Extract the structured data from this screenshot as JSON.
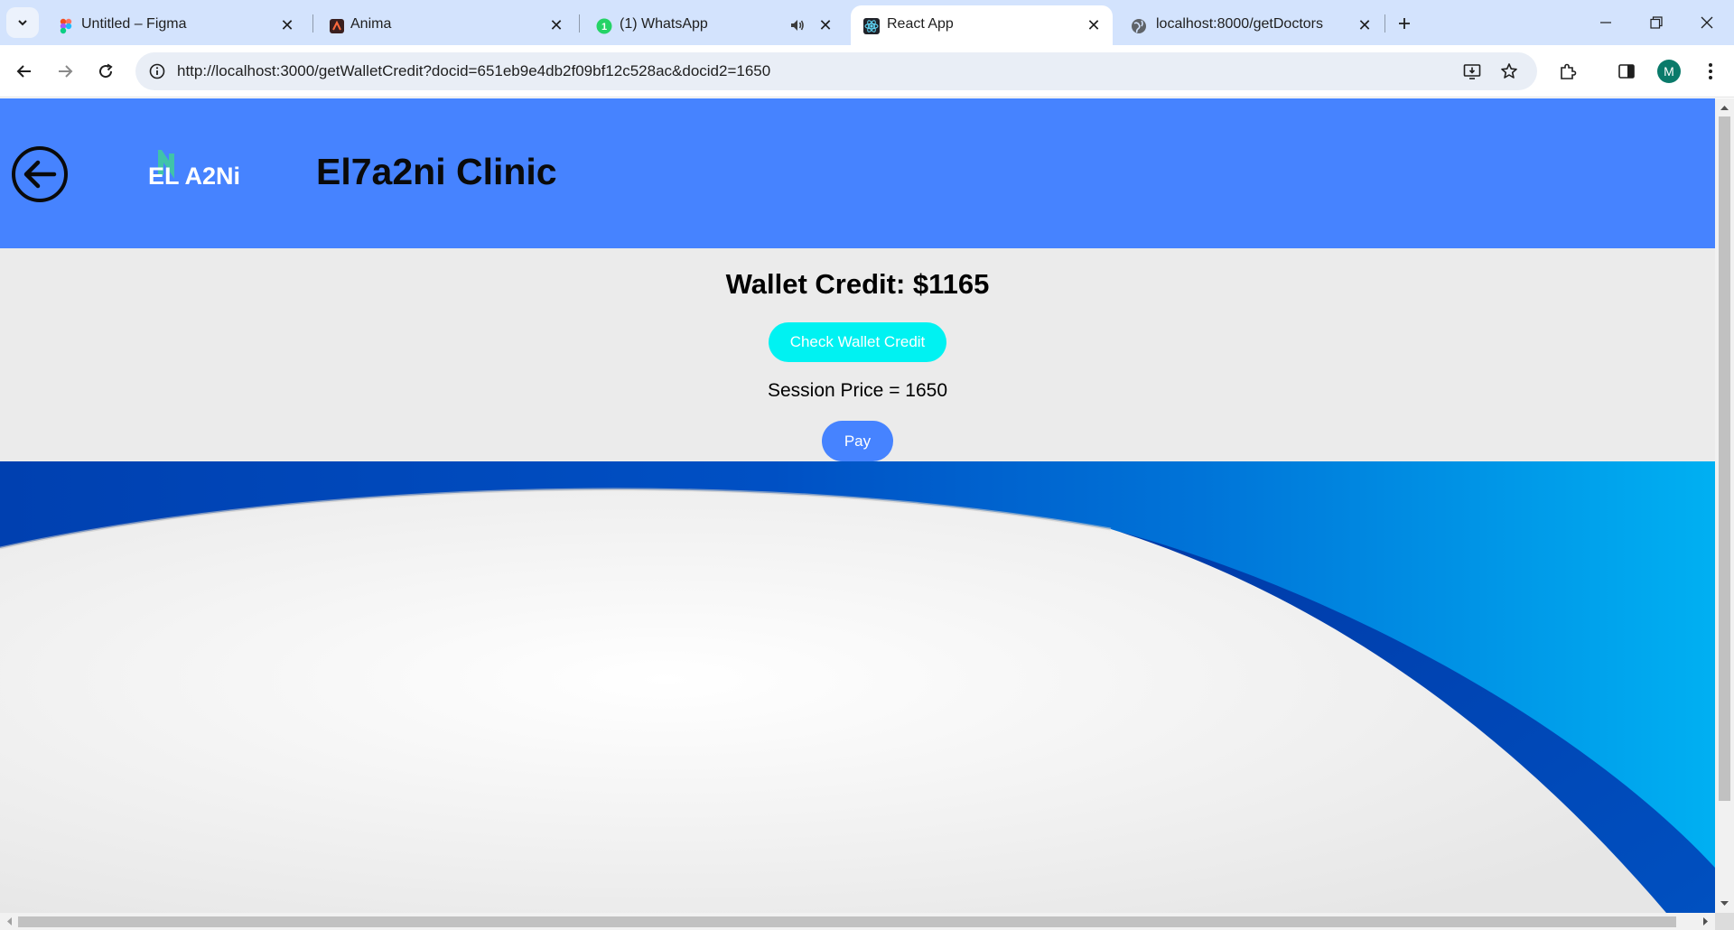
{
  "browser": {
    "tabs": [
      {
        "title": "Untitled – Figma",
        "icon": "figma-icon",
        "active": false
      },
      {
        "title": "Anima",
        "icon": "anima-icon",
        "active": false
      },
      {
        "title": "(1) WhatsApp",
        "icon": "whatsapp-icon",
        "badge": "1",
        "audio": true,
        "active": false
      },
      {
        "title": "React App",
        "icon": "react-icon",
        "active": true
      },
      {
        "title": "localhost:8000/getDoctors",
        "icon": "globe-icon",
        "active": false
      }
    ],
    "url": "http://localhost:3000/getWalletCredit?docid=651eb9e4db2f09bf12c528ac&docid2=1650",
    "profile_initial": "M"
  },
  "header": {
    "logo_text": "EL A2Ni",
    "title": "El7a2ni Clinic",
    "colors": {
      "header_bg": "#4683ff"
    }
  },
  "main": {
    "wallet_heading": "Wallet Credit: $1165",
    "check_button": "Check Wallet Credit",
    "session_price": "Session Price = 1650",
    "pay_button": "Pay"
  },
  "colors": {
    "accent_cyan": "#00f2f2",
    "accent_blue": "#4683ff",
    "wave_dark": "#0044b8",
    "wave_light": "#00a8f0"
  }
}
